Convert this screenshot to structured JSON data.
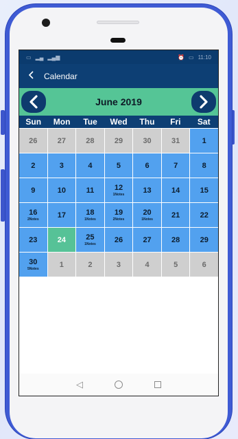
{
  "status_bar": {
    "time": "11:10"
  },
  "app_bar": {
    "title": "Calendar"
  },
  "calendar": {
    "month_label": "June 2019",
    "weekdays": [
      "Sun",
      "Mon",
      "Tue",
      "Wed",
      "Thu",
      "Fri",
      "Sat"
    ],
    "days": [
      {
        "n": "26",
        "state": "out",
        "notes": ""
      },
      {
        "n": "27",
        "state": "out",
        "notes": ""
      },
      {
        "n": "28",
        "state": "out",
        "notes": ""
      },
      {
        "n": "29",
        "state": "out",
        "notes": ""
      },
      {
        "n": "30",
        "state": "out",
        "notes": ""
      },
      {
        "n": "31",
        "state": "out",
        "notes": ""
      },
      {
        "n": "1",
        "state": "in",
        "notes": ""
      },
      {
        "n": "2",
        "state": "in",
        "notes": ""
      },
      {
        "n": "3",
        "state": "in",
        "notes": ""
      },
      {
        "n": "4",
        "state": "in",
        "notes": ""
      },
      {
        "n": "5",
        "state": "in",
        "notes": ""
      },
      {
        "n": "6",
        "state": "in",
        "notes": ""
      },
      {
        "n": "7",
        "state": "in",
        "notes": ""
      },
      {
        "n": "8",
        "state": "in",
        "notes": ""
      },
      {
        "n": "9",
        "state": "in",
        "notes": ""
      },
      {
        "n": "10",
        "state": "in",
        "notes": ""
      },
      {
        "n": "11",
        "state": "in",
        "notes": ""
      },
      {
        "n": "12",
        "state": "in",
        "notes": "1Notes"
      },
      {
        "n": "13",
        "state": "in",
        "notes": ""
      },
      {
        "n": "14",
        "state": "in",
        "notes": ""
      },
      {
        "n": "15",
        "state": "in",
        "notes": ""
      },
      {
        "n": "16",
        "state": "in",
        "notes": "2Notes"
      },
      {
        "n": "17",
        "state": "in",
        "notes": ""
      },
      {
        "n": "18",
        "state": "in",
        "notes": "1Notes"
      },
      {
        "n": "19",
        "state": "in",
        "notes": "2Notes"
      },
      {
        "n": "20",
        "state": "in",
        "notes": "1Notes"
      },
      {
        "n": "21",
        "state": "in",
        "notes": ""
      },
      {
        "n": "22",
        "state": "in",
        "notes": ""
      },
      {
        "n": "23",
        "state": "in",
        "notes": ""
      },
      {
        "n": "24",
        "state": "today",
        "notes": ""
      },
      {
        "n": "25",
        "state": "in",
        "notes": "1Notes"
      },
      {
        "n": "26",
        "state": "in",
        "notes": ""
      },
      {
        "n": "27",
        "state": "in",
        "notes": ""
      },
      {
        "n": "28",
        "state": "in",
        "notes": ""
      },
      {
        "n": "29",
        "state": "in",
        "notes": ""
      },
      {
        "n": "30",
        "state": "in",
        "notes": "5Notes"
      },
      {
        "n": "1",
        "state": "out",
        "notes": ""
      },
      {
        "n": "2",
        "state": "out",
        "notes": ""
      },
      {
        "n": "3",
        "state": "out",
        "notes": ""
      },
      {
        "n": "4",
        "state": "out",
        "notes": ""
      },
      {
        "n": "5",
        "state": "out",
        "notes": ""
      },
      {
        "n": "6",
        "state": "out",
        "notes": ""
      }
    ]
  },
  "colors": {
    "app_bar": "#0d3f74",
    "month_bar": "#55c596",
    "day_in_month": "#52a1ef",
    "day_out_month": "#cfcfcf",
    "today": "#56c297",
    "phone_frame": "#3f5bd4"
  },
  "icons": {
    "back": "arrow-left-icon",
    "prev_month": "chevron-left-icon",
    "next_month": "chevron-right-icon",
    "nav_back": "triangle-back-icon",
    "nav_home": "circle-home-icon",
    "nav_recents": "square-recents-icon"
  }
}
